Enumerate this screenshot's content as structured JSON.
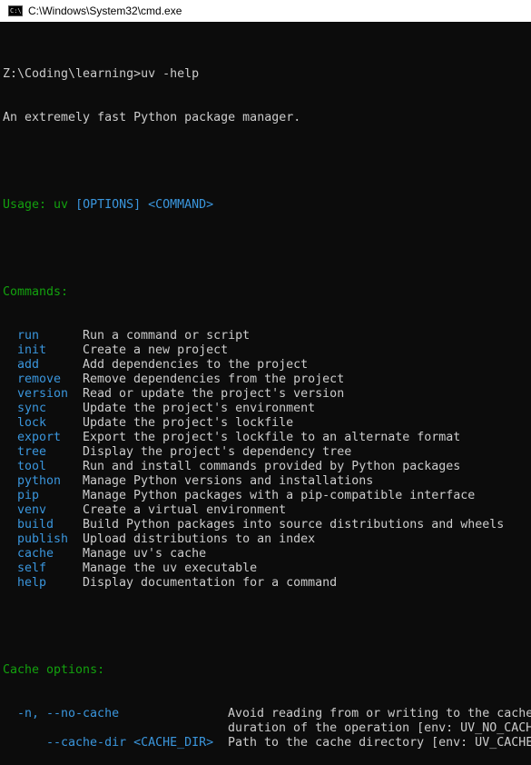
{
  "window": {
    "title": "C:\\Windows\\System32\\cmd.exe",
    "icon": "cmd-icon",
    "icon_text": "C:\\"
  },
  "console": {
    "prompt_line": "Z:\\Coding\\learning>uv -help",
    "description": "An extremely fast Python package manager.",
    "usage_label": "Usage: uv ",
    "usage_args": "[OPTIONS] <COMMAND>",
    "commands_header": "Commands:",
    "commands": [
      {
        "name": "run",
        "desc": "Run a command or script"
      },
      {
        "name": "init",
        "desc": "Create a new project"
      },
      {
        "name": "add",
        "desc": "Add dependencies to the project"
      },
      {
        "name": "remove",
        "desc": "Remove dependencies from the project"
      },
      {
        "name": "version",
        "desc": "Read or update the project's version"
      },
      {
        "name": "sync",
        "desc": "Update the project's environment"
      },
      {
        "name": "lock",
        "desc": "Update the project's lockfile"
      },
      {
        "name": "export",
        "desc": "Export the project's lockfile to an alternate format"
      },
      {
        "name": "tree",
        "desc": "Display the project's dependency tree"
      },
      {
        "name": "tool",
        "desc": "Run and install commands provided by Python packages"
      },
      {
        "name": "python",
        "desc": "Manage Python versions and installations"
      },
      {
        "name": "pip",
        "desc": "Manage Python packages with a pip-compatible interface"
      },
      {
        "name": "venv",
        "desc": "Create a virtual environment"
      },
      {
        "name": "build",
        "desc": "Build Python packages into source distributions and wheels"
      },
      {
        "name": "publish",
        "desc": "Upload distributions to an index"
      },
      {
        "name": "cache",
        "desc": "Manage uv's cache"
      },
      {
        "name": "self",
        "desc": "Manage the uv executable"
      },
      {
        "name": "help",
        "desc": "Display documentation for a command"
      }
    ],
    "cache_header": "Cache options:",
    "cache_options": [
      {
        "name": "-n, --no-cache",
        "desc": "Avoid reading from or writing to the cache"
      },
      {
        "name": "",
        "desc": "duration of the operation [env: UV_NO_CACH"
      },
      {
        "name": "    --cache-dir <CACHE_DIR>",
        "desc": "Path to the cache directory [env: UV_CACHE"
      }
    ]
  },
  "colors": {
    "background": "#0c0c0c",
    "text": "#cccccc",
    "green": "#13a10e",
    "cyan": "#3a96dd"
  }
}
